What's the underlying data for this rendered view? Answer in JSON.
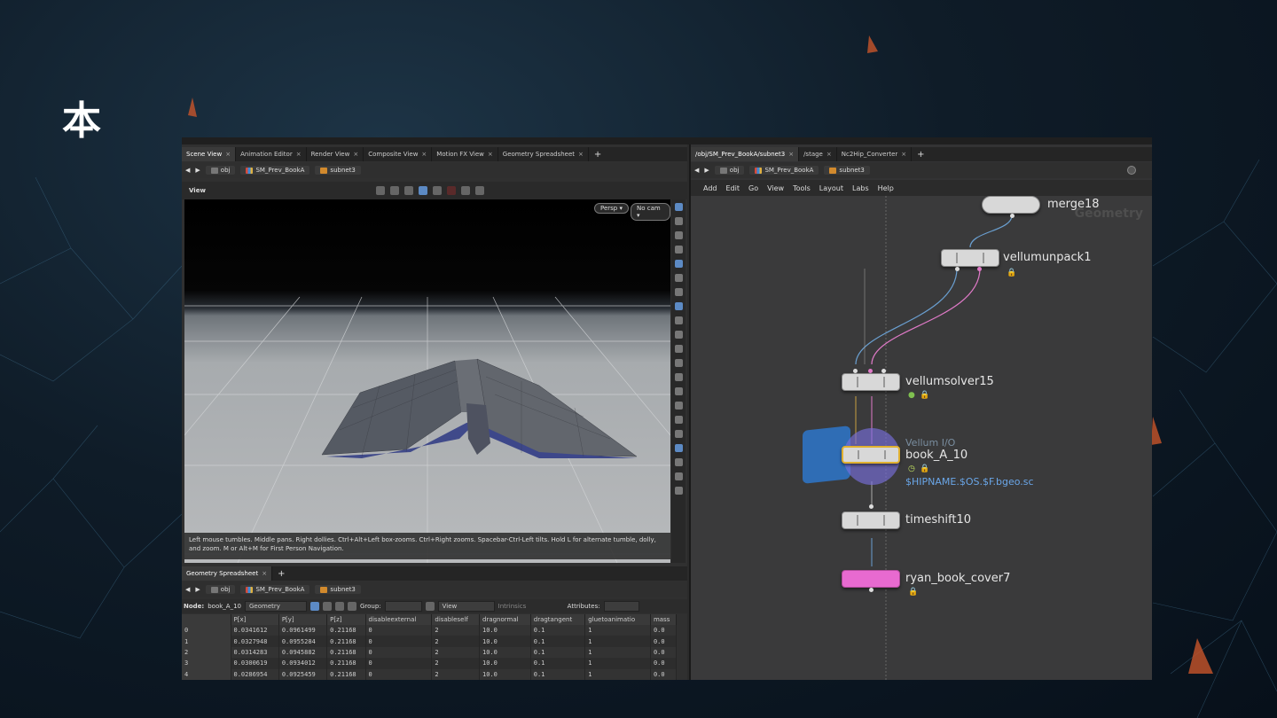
{
  "slide": {
    "title": "本"
  },
  "scene_pane": {
    "tabs": [
      {
        "label": "Scene View",
        "active": true
      },
      {
        "label": "Animation Editor"
      },
      {
        "label": "Render View"
      },
      {
        "label": "Composite View"
      },
      {
        "label": "Motion FX View"
      },
      {
        "label": "Geometry Spreadsheet"
      }
    ],
    "path": {
      "root": "obj",
      "asset": "SM_Prev_BookA",
      "subnet": "subnet3"
    },
    "view_label": "View",
    "persp_button": "Persp ▾",
    "cam_button": "No cam ▾",
    "hint": "Left mouse tumbles. Middle pans. Right dollies. Ctrl+Alt+Left box-zooms. Ctrl+Right zooms. Spacebar-Ctrl-Left tilts. Hold L for alternate tumble, dolly, and zoom.    M or Alt+M for First Person Navigation."
  },
  "spreadsheet": {
    "tab": "Geometry Spreadsheet",
    "path": {
      "root": "obj",
      "asset": "SM_Prev_BookA",
      "subnet": "subnet3"
    },
    "node_label": "Node:",
    "node_value": "book_A_10",
    "type_value": "Geometry",
    "group_label": "Group:",
    "view_value": "View",
    "intrinsics_label": "Intrinsics",
    "attributes_label": "Attributes:",
    "columns": [
      "",
      "P[x]",
      "P[y]",
      "P[z]",
      "disableexternal",
      "disableself",
      "dragnormal",
      "dragtangent",
      "gluetoanimatio",
      "mass"
    ],
    "rows": [
      [
        "0",
        "0.0341612",
        "0.0961499",
        "0.21168",
        "0",
        "2",
        "10.0",
        "0.1",
        "1",
        "0.0"
      ],
      [
        "1",
        "0.0327948",
        "0.0955284",
        "0.21168",
        "0",
        "2",
        "10.0",
        "0.1",
        "1",
        "0.0"
      ],
      [
        "2",
        "0.0314283",
        "0.0945882",
        "0.21168",
        "0",
        "2",
        "10.0",
        "0.1",
        "1",
        "0.0"
      ],
      [
        "3",
        "0.0300619",
        "0.0934012",
        "0.21168",
        "0",
        "2",
        "10.0",
        "0.1",
        "1",
        "0.0"
      ],
      [
        "4",
        "0.0286954",
        "0.0925459",
        "0.21168",
        "0",
        "2",
        "10.0",
        "0.1",
        "1",
        "0.0"
      ]
    ]
  },
  "network_pane": {
    "tabs": [
      {
        "label": "/obj/SM_Prev_BookA/subnet3",
        "active": true
      },
      {
        "label": "/stage"
      },
      {
        "label": "Nc2Hip_Converter"
      }
    ],
    "path": {
      "root": "obj",
      "asset": "SM_Prev_BookA",
      "subnet": "subnet3"
    },
    "menu": [
      "Add",
      "Edit",
      "Go",
      "View",
      "Tools",
      "Layout",
      "Labs",
      "Help"
    ],
    "context_label": "Geometry",
    "nodes": {
      "merge": "merge18",
      "unpack": "vellumunpack1",
      "solver": "vellumsolver15",
      "io_type": "Vellum I/O",
      "io_name": "book_A_10",
      "io_expr": "$HIPNAME.$OS.$F.bgeo.sc",
      "timeshift": "timeshift10",
      "output": "ryan_book_cover7"
    }
  },
  "colors": {
    "accent": "#e07ac8",
    "wire_blue": "#6a9fd0",
    "null_node": "#e86ad0",
    "file_blue": "#2f6db5"
  }
}
